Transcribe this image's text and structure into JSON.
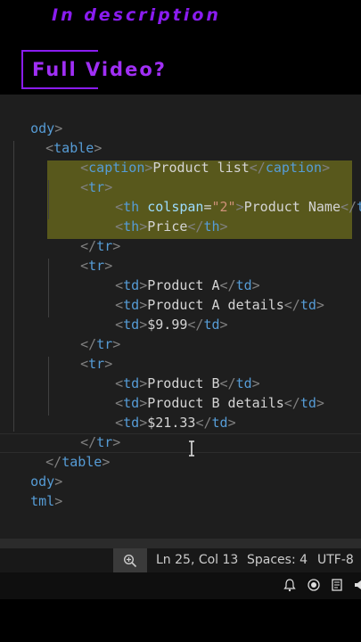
{
  "overlay": {
    "description_text": "In description",
    "full_video_text": "Full Video?"
  },
  "editor": {
    "lines": [
      {
        "open": "",
        "tag": "ody",
        "close": ">"
      },
      {
        "open": "<",
        "tag": "table",
        "close": ">"
      },
      {
        "caption_open": "<",
        "caption_tag": "caption",
        "caption_gt": ">",
        "text": "Product list",
        "caption_close_lt": "</",
        "caption_close_tag": "caption",
        "caption_close_gt": ">"
      },
      {
        "open": "<",
        "tag": "tr",
        "close": ">"
      },
      {
        "lt": "<",
        "tag": "th",
        "attr": "colspan",
        "eq": "=",
        "val": "\"2\"",
        "gt": ">",
        "text": "Product Name",
        "close_lt": "</",
        "close_tag": "th"
      },
      {
        "lt": "<",
        "tag": "th",
        "gt": ">",
        "text": "Price",
        "close_lt": "</",
        "close_tag": "th",
        "close_gt": ">"
      },
      {
        "open": "</",
        "tag": "tr",
        "close": ">"
      },
      {
        "open": "<",
        "tag": "tr",
        "close": ">"
      },
      {
        "lt": "<",
        "tag": "td",
        "gt": ">",
        "text": "Product A",
        "close_lt": "</",
        "close_tag": "td",
        "close_gt": ">"
      },
      {
        "lt": "<",
        "tag": "td",
        "gt": ">",
        "text": "Product A details",
        "close_lt": "</",
        "close_tag": "td",
        "close_gt": ">"
      },
      {
        "lt": "<",
        "tag": "td",
        "gt": ">",
        "text": "$9.99",
        "close_lt": "</",
        "close_tag": "td",
        "close_gt": ">"
      },
      {
        "open": "</",
        "tag": "tr",
        "close": ">"
      },
      {
        "open": "<",
        "tag": "tr",
        "close": ">"
      },
      {
        "lt": "<",
        "tag": "td",
        "gt": ">",
        "text": "Product B",
        "close_lt": "</",
        "close_tag": "td",
        "close_gt": ">"
      },
      {
        "lt": "<",
        "tag": "td",
        "gt": ">",
        "text": "Product B details",
        "close_lt": "</",
        "close_tag": "td",
        "close_gt": ">"
      },
      {
        "lt": "<",
        "tag": "td",
        "gt": ">",
        "text": "$21.33",
        "close_lt": "</",
        "close_tag": "td",
        "close_gt": ">"
      },
      {
        "open": "</",
        "tag": "tr",
        "close": ">"
      },
      {
        "open": "</",
        "tag": "table",
        "close": ">"
      },
      {
        "open": "",
        "tag": "ody",
        "close": ">"
      },
      {
        "open": "",
        "tag": "tml",
        "close": ">"
      }
    ]
  },
  "statusbar": {
    "position": "Ln 25, Col 13",
    "spaces": "Spaces: 4",
    "encoding": "UTF-8"
  },
  "colors": {
    "accent_purple": "#8a1cf0",
    "selection": "#63631c",
    "tag": "#569cd6",
    "bracket": "#808080",
    "attr_name": "#9cdcfe",
    "attr_value": "#ce9178"
  },
  "icons": [
    "zoom-in-icon",
    "bell-icon",
    "broadcast-icon",
    "notes-icon",
    "speaker-icon"
  ]
}
